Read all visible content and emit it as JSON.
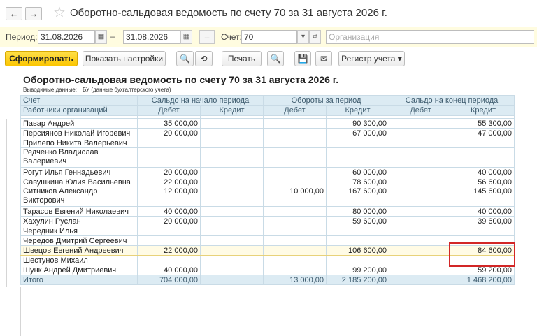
{
  "window": {
    "title": "Оборотно-сальдовая ведомость по счету 70 за 31 августа 2026 г.",
    "back_icon": "←",
    "forward_icon": "→",
    "favorite_icon": "☆"
  },
  "params": {
    "period_label": "Период:",
    "date_from": "31.08.2026",
    "date_to": "31.08.2026",
    "dash": "–",
    "more_label": "...",
    "account_label": "Счет:",
    "account_value": "70",
    "organization_placeholder": "Организация",
    "calendar_icon": "▦",
    "dropdown_icon": "▾",
    "open_icon": "⧉"
  },
  "toolbar": {
    "generate_label": "Сформировать",
    "show_settings_label": "Показать настройки",
    "search_icon": "🔍",
    "search_cancel_icon": "⟲",
    "print_label": "Печать",
    "preview_icon": "🔍",
    "save_icon": "💾",
    "mail_icon": "✉",
    "register_label": "Регистр учета",
    "register_arrow": "▾"
  },
  "report": {
    "title": "Оборотно-сальдовая ведомость по счету 70 за 31 августа 2026 г.",
    "output_label": "Выводимые данные:",
    "output_value": "БУ (данные бухгалтерского учета)",
    "headers": {
      "account": "Счет",
      "employees": "Работники организаций",
      "opening_balance": "Сальдо на начало периода",
      "turnover": "Обороты за период",
      "closing_balance": "Сальдо на конец периода",
      "debit": "Дебет",
      "credit": "Кредит"
    },
    "rows": [
      {
        "name": "Павар Андрей",
        "od": "35 000,00",
        "oc": "",
        "td": "",
        "tc": "90 300,00",
        "cd": "",
        "cc": "55 300,00"
      },
      {
        "name": "Персиянов Николай Игоревич",
        "od": "20 000,00",
        "oc": "",
        "td": "",
        "tc": "67 000,00",
        "cd": "",
        "cc": "47 000,00"
      },
      {
        "name": "Прилепо Никита Валерьевич",
        "od": "",
        "oc": "",
        "td": "",
        "tc": "",
        "cd": "",
        "cc": ""
      },
      {
        "name": "Редченко Владислав Валериевич",
        "od": "",
        "oc": "",
        "td": "",
        "tc": "",
        "cd": "",
        "cc": ""
      },
      {
        "name": "Рогут Илья Геннадьевич",
        "od": "20 000,00",
        "oc": "",
        "td": "",
        "tc": "60 000,00",
        "cd": "",
        "cc": "40 000,00"
      },
      {
        "name": "Савушкина Юлия Васильевна",
        "od": "22 000,00",
        "oc": "",
        "td": "",
        "tc": "78 600,00",
        "cd": "",
        "cc": "56 600,00"
      },
      {
        "name": "Ситников Александр Викторович",
        "od": "12 000,00",
        "oc": "",
        "td": "10 000,00",
        "tc": "167 600,00",
        "cd": "",
        "cc": "145 600,00"
      },
      {
        "name": "Тарасов Евгений Николаевич",
        "od": "40 000,00",
        "oc": "",
        "td": "",
        "tc": "80 000,00",
        "cd": "",
        "cc": "40 000,00"
      },
      {
        "name": "Хахулин Руслан",
        "od": "20 000,00",
        "oc": "",
        "td": "",
        "tc": "59 600,00",
        "cd": "",
        "cc": "39 600,00"
      },
      {
        "name": "Чередник Илья",
        "od": "",
        "oc": "",
        "td": "",
        "tc": "",
        "cd": "",
        "cc": ""
      },
      {
        "name": "Чередов Дмитрий Сергеевич",
        "od": "",
        "oc": "",
        "td": "",
        "tc": "",
        "cd": "",
        "cc": ""
      },
      {
        "name": "Швецов Евгений Андреевич",
        "od": "22 000,00",
        "oc": "",
        "td": "",
        "tc": "106 600,00",
        "cd": "",
        "cc": "84 600,00"
      },
      {
        "name": "Шестунов Михаил",
        "od": "",
        "oc": "",
        "td": "",
        "tc": "",
        "cd": "",
        "cc": ""
      },
      {
        "name": "Шунк Андрей Дмитриевич",
        "od": "40 000,00",
        "oc": "",
        "td": "",
        "tc": "99 200,00",
        "cd": "",
        "cc": "59 200,00"
      }
    ],
    "total": {
      "name": "Итого",
      "od": "704 000,00",
      "oc": "",
      "td": "13 000,00",
      "tc": "2 185 200,00",
      "cd": "",
      "cc": "1 468 200,00"
    }
  },
  "colors": {
    "header_bg": "#dcebf3",
    "params_bg": "#fffce0",
    "primary_button": "#fbc500",
    "highlight_box": "#d22626"
  }
}
